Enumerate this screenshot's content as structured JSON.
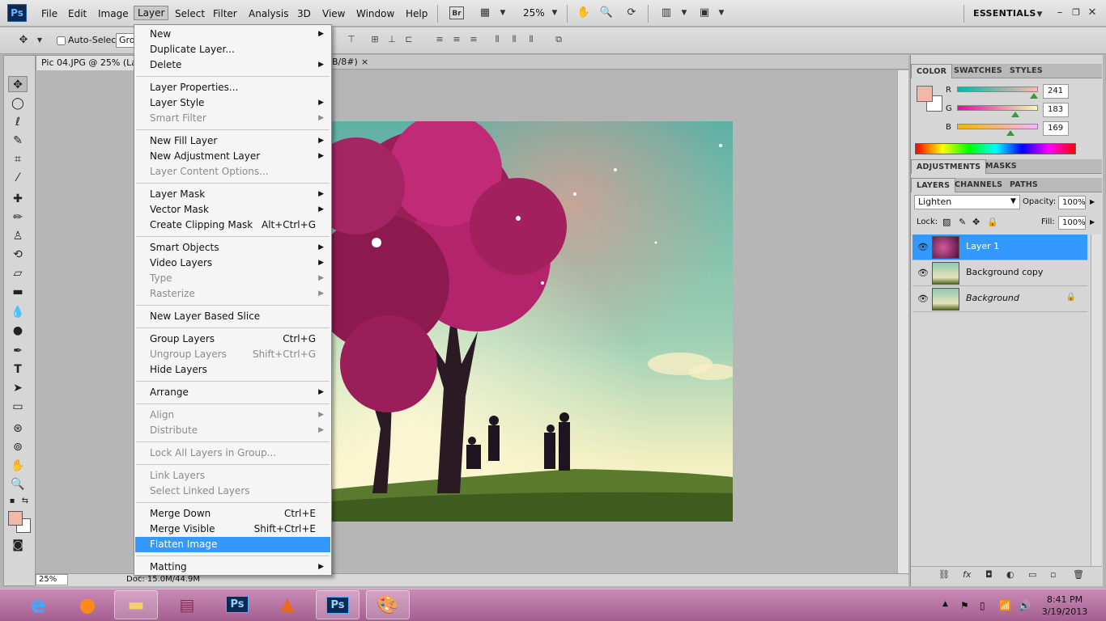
{
  "app": {
    "logo": "Ps"
  },
  "menubar": {
    "items": [
      "File",
      "Edit",
      "Image",
      "Layer",
      "Select",
      "Filter",
      "Analysis",
      "3D",
      "View",
      "Window",
      "Help"
    ],
    "zoom": "25%",
    "workspace": "ESSENTIALS"
  },
  "options": {
    "auto_select": "Auto-Select:",
    "auto_select_value": "Gro"
  },
  "document": {
    "tab_title": "Pic 04.JPG @ 25% (Layer 1, RGB/8#)",
    "tab_suffix": "B/8#)",
    "close": "×",
    "status_zoom": "25%",
    "status_doc": "Doc: 15.0M/44.9M"
  },
  "layer_menu": {
    "items": [
      {
        "label": "New",
        "shortcut": "",
        "submenu": true,
        "disabled": false
      },
      {
        "label": "Duplicate Layer...",
        "shortcut": "",
        "submenu": false,
        "disabled": false
      },
      {
        "label": "Delete",
        "shortcut": "",
        "submenu": true,
        "disabled": false
      },
      {
        "label": "Layer Properties...",
        "shortcut": "",
        "submenu": false,
        "disabled": false
      },
      {
        "label": "Layer Style",
        "shortcut": "",
        "submenu": true,
        "disabled": false
      },
      {
        "label": "Smart Filter",
        "shortcut": "",
        "submenu": true,
        "disabled": true
      },
      {
        "label": "New Fill Layer",
        "shortcut": "",
        "submenu": true,
        "disabled": false
      },
      {
        "label": "New Adjustment Layer",
        "shortcut": "",
        "submenu": true,
        "disabled": false
      },
      {
        "label": "Layer Content Options...",
        "shortcut": "",
        "submenu": false,
        "disabled": true
      },
      {
        "label": "Layer Mask",
        "shortcut": "",
        "submenu": true,
        "disabled": false
      },
      {
        "label": "Vector Mask",
        "shortcut": "",
        "submenu": true,
        "disabled": false
      },
      {
        "label": "Create Clipping Mask",
        "shortcut": "Alt+Ctrl+G",
        "submenu": false,
        "disabled": false
      },
      {
        "label": "Smart Objects",
        "shortcut": "",
        "submenu": true,
        "disabled": false
      },
      {
        "label": "Video Layers",
        "shortcut": "",
        "submenu": true,
        "disabled": false
      },
      {
        "label": "Type",
        "shortcut": "",
        "submenu": true,
        "disabled": true
      },
      {
        "label": "Rasterize",
        "shortcut": "",
        "submenu": true,
        "disabled": true
      },
      {
        "label": "New Layer Based Slice",
        "shortcut": "",
        "submenu": false,
        "disabled": false
      },
      {
        "label": "Group Layers",
        "shortcut": "Ctrl+G",
        "submenu": false,
        "disabled": false
      },
      {
        "label": "Ungroup Layers",
        "shortcut": "Shift+Ctrl+G",
        "submenu": false,
        "disabled": true
      },
      {
        "label": "Hide Layers",
        "shortcut": "",
        "submenu": false,
        "disabled": false
      },
      {
        "label": "Arrange",
        "shortcut": "",
        "submenu": true,
        "disabled": false
      },
      {
        "label": "Align",
        "shortcut": "",
        "submenu": true,
        "disabled": true
      },
      {
        "label": "Distribute",
        "shortcut": "",
        "submenu": true,
        "disabled": true
      },
      {
        "label": "Lock All Layers in Group...",
        "shortcut": "",
        "submenu": false,
        "disabled": true
      },
      {
        "label": "Link Layers",
        "shortcut": "",
        "submenu": false,
        "disabled": true
      },
      {
        "label": "Select Linked Layers",
        "shortcut": "",
        "submenu": false,
        "disabled": true
      },
      {
        "label": "Merge Down",
        "shortcut": "Ctrl+E",
        "submenu": false,
        "disabled": false
      },
      {
        "label": "Merge Visible",
        "shortcut": "Shift+Ctrl+E",
        "submenu": false,
        "disabled": false
      },
      {
        "label": "Flatten Image",
        "shortcut": "",
        "submenu": false,
        "disabled": false,
        "highlighted": true
      },
      {
        "label": "Matting",
        "shortcut": "",
        "submenu": true,
        "disabled": false
      }
    ]
  },
  "color_panel": {
    "tabs": [
      "COLOR",
      "SWATCHES",
      "STYLES"
    ],
    "r_label": "R",
    "g_label": "G",
    "b_label": "B",
    "r": "241",
    "g": "183",
    "b": "169",
    "r_fraction": 0.945,
    "g_fraction": 0.718,
    "b_fraction": 0.663,
    "foreground": "#f1b7a9",
    "background": "#ffffff"
  },
  "adjust_tabs": [
    "ADJUSTMENTS",
    "MASKS"
  ],
  "layers_panel": {
    "tabs": [
      "LAYERS",
      "CHANNELS",
      "PATHS"
    ],
    "blend_mode": "Lighten",
    "opacity_label": "Opacity:",
    "opacity": "100%",
    "lock_label": "Lock:",
    "fill_label": "Fill:",
    "fill": "100%",
    "layers": [
      {
        "name": "Layer 1",
        "selected": true,
        "locked": false
      },
      {
        "name": "Background copy",
        "selected": false,
        "locked": false
      },
      {
        "name": "Background",
        "selected": false,
        "locked": true
      }
    ]
  },
  "taskbar": {
    "apps": [
      "ie-icon",
      "firefox-icon",
      "explorer-icon",
      "winrar-icon",
      "photoshop-icon",
      "matlab-icon",
      "photoshop-active-icon",
      "paint-icon"
    ],
    "time": "8:41 PM",
    "date": "3/19/2013"
  },
  "accent": "#3399ff"
}
